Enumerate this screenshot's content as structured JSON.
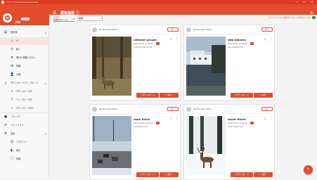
{
  "window": {
    "title": "Tiny TT Sub Media Downloader",
    "controls": [
      "—",
      "☐",
      "✕"
    ]
  },
  "app": {
    "name": "_tiki",
    "version": "1.6.6",
    "menu_icon": "menu-icon",
    "page_title": "閲覧履歴 ⓘ",
    "refresh_icon": "refresh-icon",
    "brand_color": "#e34c2c"
  },
  "toolbar": {
    "sort_label": "並べ替え",
    "sort_value": "記録のタイトル",
    "search_value": "結果",
    "search_icon": "search-icon",
    "autodownload_label": "ホームページから自動ダウンロードを有効にします",
    "autodownload_on": true
  },
  "sidebar": {
    "items": [
      {
        "icon": "library-icon",
        "label": "図書館",
        "chevron": "∧",
        "level": 0
      },
      {
        "icon": "home-icon",
        "label": "家",
        "level": 1,
        "active": true
      },
      {
        "icon": "history-icon",
        "label": "続く",
        "level": 1
      },
      {
        "icon": "star-icon",
        "label": "現代の視聴されたく",
        "level": 1
      },
      {
        "icon": "clock-icon",
        "label": "詳細",
        "level": 1
      },
      {
        "icon": "user-icon",
        "label": "公開",
        "level": 1
      },
      {
        "icon": "download-icon",
        "label": "ダウンロード/アップロード",
        "chevron": "∧",
        "level": 0
      },
      {
        "icon": "download-icon",
        "label": "ダウンロード中",
        "level": 1
      },
      {
        "icon": "upload-icon",
        "label": "アップロード中",
        "level": 1
      },
      {
        "icon": "done-icon",
        "label": "ダウンロード完了",
        "level": 1
      },
      {
        "icon": "player-icon",
        "label": "プレーヤー",
        "level": 0
      },
      {
        "icon": "playlist-icon",
        "label": "プレイリスト",
        "level": 0
      },
      {
        "icon": "settings-icon",
        "label": "設定",
        "chevron": "∧",
        "level": 0
      },
      {
        "icon": "account-icon",
        "label": "アカウント",
        "level": 1
      },
      {
        "icon": "display-icon",
        "label": "表示",
        "level": 1
      },
      {
        "icon": "info-icon",
        "label": "情報",
        "level": 1
      }
    ]
  },
  "cards": [
    {
      "author": "Quota short films",
      "follow_label": "続く",
      "title": "clément proust",
      "date": "2022/12/15 13:46:25",
      "file": "clément proust.mp4",
      "download_label": "ダウンロード",
      "open_label": "表示 ›",
      "scene": "forest"
    },
    {
      "author": "Quota short films",
      "follow_label": "続く",
      "title": "otjo dijkstra",
      "date": "2022/12/15 13:46:25",
      "file": "otjo dijkstra.mp4",
      "download_label": "ダウンロード",
      "open_label": "表示 ›",
      "scene": "lake"
    },
    {
      "author": "Quota short films",
      "follow_label": "続く",
      "title": "maxi haiva",
      "date": "2022/12/15 13:46:25",
      "file": "maxihaiva.mp4",
      "download_label": "ダウンロード",
      "open_label": "表示 ›",
      "scene": "road"
    },
    {
      "author": "Quota short films",
      "follow_label": "続く",
      "title": "sauer ffores",
      "date": "2022/12/15 13:46:25",
      "file": "sauer ffores.mp4",
      "download_label": "ダウンロード",
      "open_label": "表示 ›",
      "scene": "deer"
    }
  ],
  "fab": {
    "icon": "chat-icon"
  }
}
